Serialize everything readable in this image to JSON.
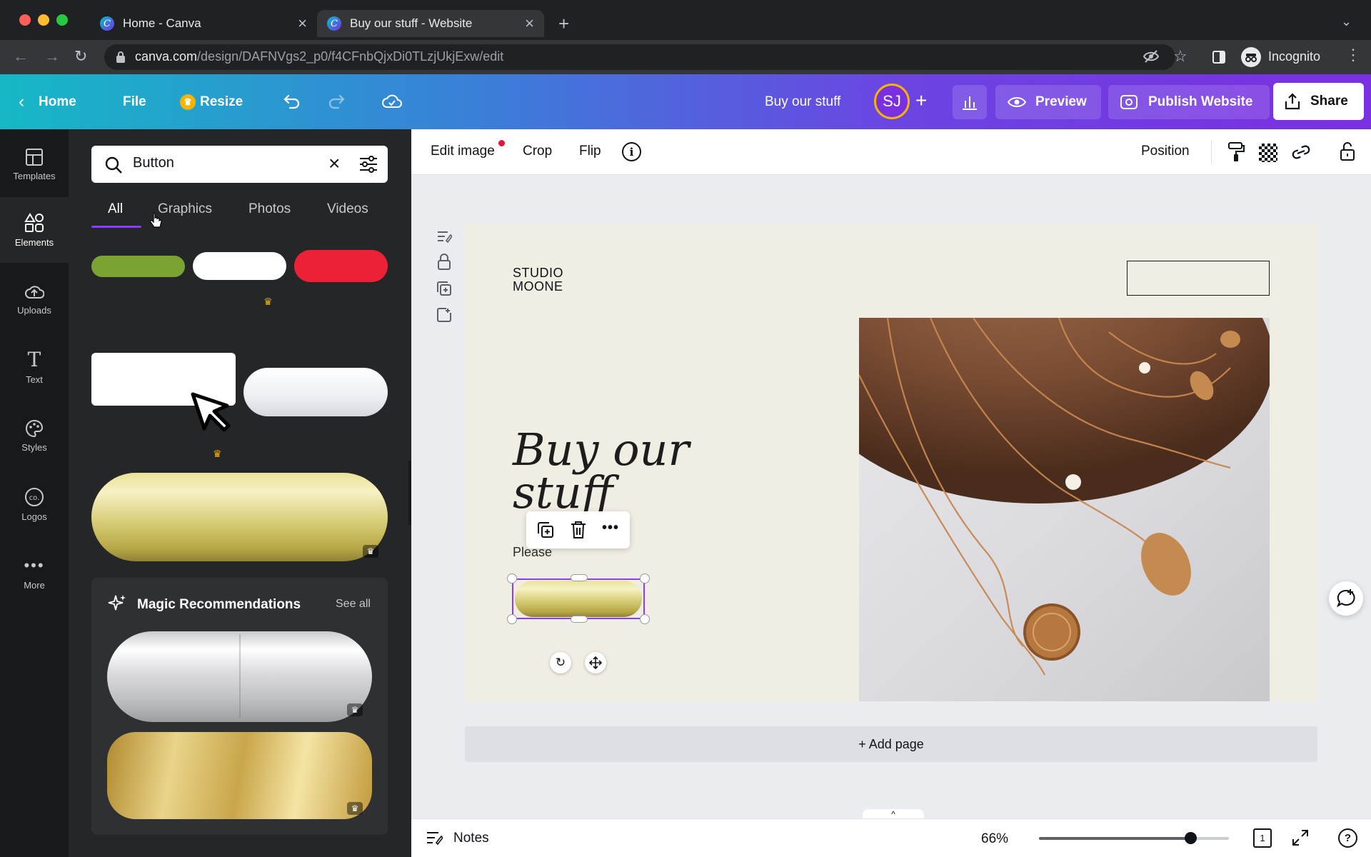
{
  "browser": {
    "tabs": [
      {
        "title": "Home - Canva",
        "active": false
      },
      {
        "title": "Buy our stuff - Website",
        "active": true
      }
    ],
    "url_host": "canva.com",
    "url_path": "/design/DAFNVgs2_p0/f4CFnbQjxDi0TLzjUkjExw/edit",
    "profile_label": "Incognito"
  },
  "header": {
    "home": "Home",
    "file": "File",
    "resize": "Resize",
    "design_title": "Buy our stuff",
    "avatar_initials": "SJ",
    "preview": "Preview",
    "publish": "Publish Website",
    "share": "Share"
  },
  "rail": [
    {
      "label": "Templates",
      "icon": "templates-icon"
    },
    {
      "label": "Elements",
      "icon": "elements-icon",
      "active": true
    },
    {
      "label": "Uploads",
      "icon": "uploads-icon"
    },
    {
      "label": "Text",
      "icon": "text-icon"
    },
    {
      "label": "Styles",
      "icon": "styles-icon"
    },
    {
      "label": "Logos",
      "icon": "logos-icon"
    },
    {
      "label": "More",
      "icon": "more-icon"
    }
  ],
  "panel": {
    "search_value": "Button",
    "tabs": [
      "All",
      "Graphics",
      "Photos",
      "Videos"
    ],
    "active_tab": "All",
    "magic_title": "Magic Recommendations",
    "see_all": "See all"
  },
  "toolbar": {
    "edit_image": "Edit image",
    "crop": "Crop",
    "flip": "Flip",
    "position": "Position"
  },
  "canvas": {
    "logo_line1": "STUDIO",
    "logo_line2": "MOONE",
    "heading_line1": "Buy our",
    "heading_line2": "stuff",
    "body_text": "Please",
    "add_page": "+ Add page"
  },
  "footer": {
    "notes": "Notes",
    "zoom": "66%",
    "page_count": "1",
    "zoom_fraction": 0.66
  },
  "colors": {
    "accent": "#8b3dff",
    "gold": "#c9b455",
    "green_button": "#7aa332",
    "red_button": "#ec2135"
  }
}
